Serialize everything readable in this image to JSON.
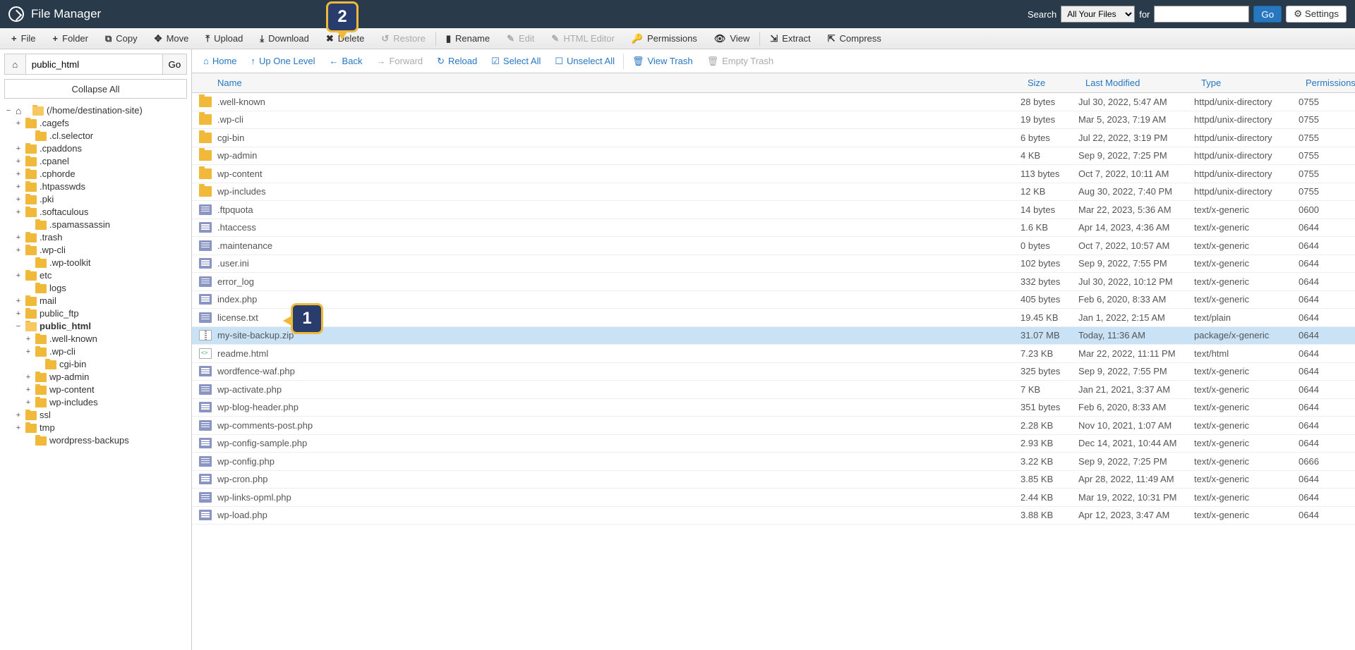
{
  "title": "File Manager",
  "header": {
    "search_label": "Search",
    "search_scope": "All Your Files",
    "for_label": "for",
    "search_value": "",
    "go": "Go",
    "settings": "Settings"
  },
  "toolbar": [
    {
      "id": "file",
      "icon": "+",
      "label": "File",
      "disabled": false
    },
    {
      "id": "folder",
      "icon": "+",
      "label": "Folder",
      "disabled": false
    },
    {
      "id": "copy",
      "icon": "⧉",
      "label": "Copy",
      "disabled": false
    },
    {
      "id": "move",
      "icon": "✥",
      "label": "Move",
      "disabled": false
    },
    {
      "id": "upload",
      "icon": "⤒",
      "label": "Upload",
      "disabled": false
    },
    {
      "id": "download",
      "icon": "⤓",
      "label": "Download",
      "disabled": false
    },
    {
      "id": "delete",
      "icon": "✖",
      "label": "Delete",
      "disabled": false
    },
    {
      "id": "restore",
      "icon": "↺",
      "label": "Restore",
      "disabled": true,
      "sep": true
    },
    {
      "id": "rename",
      "icon": "▮",
      "label": "Rename",
      "disabled": false
    },
    {
      "id": "edit",
      "icon": "✎",
      "label": "Edit",
      "disabled": true
    },
    {
      "id": "htmleditor",
      "icon": "✎",
      "label": "HTML Editor",
      "disabled": true
    },
    {
      "id": "permissions",
      "icon": "🔑",
      "label": "Permissions",
      "disabled": false
    },
    {
      "id": "view",
      "icon": "👁",
      "label": "View",
      "disabled": false,
      "sep": true
    },
    {
      "id": "extract",
      "icon": "⇲",
      "label": "Extract",
      "disabled": false
    },
    {
      "id": "compress",
      "icon": "⇱",
      "label": "Compress",
      "disabled": false
    }
  ],
  "pathbar": {
    "value": "public_html",
    "go": "Go"
  },
  "collapse": "Collapse All",
  "tree": [
    {
      "tw": "−",
      "icon": "home",
      "label": "(/home/destination-site)",
      "depth": 0,
      "open": true
    },
    {
      "tw": "+",
      "icon": "folder",
      "label": ".cagefs",
      "depth": 1
    },
    {
      "tw": "",
      "icon": "folder",
      "label": ".cl.selector",
      "depth": 2
    },
    {
      "tw": "+",
      "icon": "folder",
      "label": ".cpaddons",
      "depth": 1
    },
    {
      "tw": "+",
      "icon": "folder",
      "label": ".cpanel",
      "depth": 1
    },
    {
      "tw": "+",
      "icon": "folder",
      "label": ".cphorde",
      "depth": 1
    },
    {
      "tw": "+",
      "icon": "folder",
      "label": ".htpasswds",
      "depth": 1
    },
    {
      "tw": "+",
      "icon": "folder",
      "label": ".pki",
      "depth": 1
    },
    {
      "tw": "+",
      "icon": "folder",
      "label": ".softaculous",
      "depth": 1
    },
    {
      "tw": "",
      "icon": "folder",
      "label": ".spamassassin",
      "depth": 2
    },
    {
      "tw": "+",
      "icon": "folder",
      "label": ".trash",
      "depth": 1
    },
    {
      "tw": "+",
      "icon": "folder",
      "label": ".wp-cli",
      "depth": 1
    },
    {
      "tw": "",
      "icon": "folder",
      "label": ".wp-toolkit",
      "depth": 2
    },
    {
      "tw": "+",
      "icon": "folder",
      "label": "etc",
      "depth": 1
    },
    {
      "tw": "",
      "icon": "folder",
      "label": "logs",
      "depth": 2
    },
    {
      "tw": "+",
      "icon": "folder",
      "label": "mail",
      "depth": 1
    },
    {
      "tw": "+",
      "icon": "folder",
      "label": "public_ftp",
      "depth": 1
    },
    {
      "tw": "−",
      "icon": "folder",
      "label": "public_html",
      "depth": 1,
      "open": true,
      "bold": true
    },
    {
      "tw": "+",
      "icon": "folder",
      "label": ".well-known",
      "depth": 2
    },
    {
      "tw": "+",
      "icon": "folder",
      "label": ".wp-cli",
      "depth": 2
    },
    {
      "tw": "",
      "icon": "folder",
      "label": "cgi-bin",
      "depth": 3
    },
    {
      "tw": "+",
      "icon": "folder",
      "label": "wp-admin",
      "depth": 2
    },
    {
      "tw": "+",
      "icon": "folder",
      "label": "wp-content",
      "depth": 2
    },
    {
      "tw": "+",
      "icon": "folder",
      "label": "wp-includes",
      "depth": 2
    },
    {
      "tw": "+",
      "icon": "folder",
      "label": "ssl",
      "depth": 1
    },
    {
      "tw": "+",
      "icon": "folder",
      "label": "tmp",
      "depth": 1
    },
    {
      "tw": "",
      "icon": "folder",
      "label": "wordpress-backups",
      "depth": 2
    }
  ],
  "actionbar": [
    {
      "id": "home",
      "icon": "⌂",
      "label": "Home"
    },
    {
      "id": "up",
      "icon": "↑",
      "label": "Up One Level"
    },
    {
      "id": "back",
      "icon": "←",
      "label": "Back"
    },
    {
      "id": "forward",
      "icon": "→",
      "label": "Forward",
      "dis": true
    },
    {
      "id": "reload",
      "icon": "↻",
      "label": "Reload"
    },
    {
      "id": "selectall",
      "icon": "☑",
      "label": "Select All"
    },
    {
      "id": "unselectall",
      "icon": "☐",
      "label": "Unselect All",
      "sep": true
    },
    {
      "id": "viewtrash",
      "icon": "🗑",
      "label": "View Trash"
    },
    {
      "id": "emptytrash",
      "icon": "🗑",
      "label": "Empty Trash",
      "dis": true
    }
  ],
  "columns": {
    "name": "Name",
    "size": "Size",
    "mod": "Last Modified",
    "type": "Type",
    "perm": "Permissions"
  },
  "files": [
    {
      "icon": "folder",
      "name": ".well-known",
      "size": "28 bytes",
      "mod": "Jul 30, 2022, 5:47 AM",
      "type": "httpd/unix-directory",
      "perm": "0755"
    },
    {
      "icon": "folder",
      "name": ".wp-cli",
      "size": "19 bytes",
      "mod": "Mar 5, 2023, 7:19 AM",
      "type": "httpd/unix-directory",
      "perm": "0755"
    },
    {
      "icon": "folder",
      "name": "cgi-bin",
      "size": "6 bytes",
      "mod": "Jul 22, 2022, 3:19 PM",
      "type": "httpd/unix-directory",
      "perm": "0755"
    },
    {
      "icon": "folder",
      "name": "wp-admin",
      "size": "4 KB",
      "mod": "Sep 9, 2022, 7:25 PM",
      "type": "httpd/unix-directory",
      "perm": "0755"
    },
    {
      "icon": "folder",
      "name": "wp-content",
      "size": "113 bytes",
      "mod": "Oct 7, 2022, 10:11 AM",
      "type": "httpd/unix-directory",
      "perm": "0755"
    },
    {
      "icon": "folder",
      "name": "wp-includes",
      "size": "12 KB",
      "mod": "Aug 30, 2022, 7:40 PM",
      "type": "httpd/unix-directory",
      "perm": "0755"
    },
    {
      "icon": "file",
      "name": ".ftpquota",
      "size": "14 bytes",
      "mod": "Mar 22, 2023, 5:36 AM",
      "type": "text/x-generic",
      "perm": "0600"
    },
    {
      "icon": "file",
      "name": ".htaccess",
      "size": "1.6 KB",
      "mod": "Apr 14, 2023, 4:36 AM",
      "type": "text/x-generic",
      "perm": "0644"
    },
    {
      "icon": "file",
      "name": ".maintenance",
      "size": "0 bytes",
      "mod": "Oct 7, 2022, 10:57 AM",
      "type": "text/x-generic",
      "perm": "0644"
    },
    {
      "icon": "file",
      "name": ".user.ini",
      "size": "102 bytes",
      "mod": "Sep 9, 2022, 7:55 PM",
      "type": "text/x-generic",
      "perm": "0644"
    },
    {
      "icon": "file",
      "name": "error_log",
      "size": "332 bytes",
      "mod": "Jul 30, 2022, 10:12 PM",
      "type": "text/x-generic",
      "perm": "0644"
    },
    {
      "icon": "file",
      "name": "index.php",
      "size": "405 bytes",
      "mod": "Feb 6, 2020, 8:33 AM",
      "type": "text/x-generic",
      "perm": "0644"
    },
    {
      "icon": "file",
      "name": "license.txt",
      "size": "19.45 KB",
      "mod": "Jan 1, 2022, 2:15 AM",
      "type": "text/plain",
      "perm": "0644"
    },
    {
      "icon": "zip",
      "name": "my-site-backup.zip",
      "size": "31.07 MB",
      "mod": "Today, 11:36 AM",
      "type": "package/x-generic",
      "perm": "0644",
      "selected": true
    },
    {
      "icon": "html",
      "name": "readme.html",
      "size": "7.23 KB",
      "mod": "Mar 22, 2022, 11:11 PM",
      "type": "text/html",
      "perm": "0644"
    },
    {
      "icon": "file",
      "name": "wordfence-waf.php",
      "size": "325 bytes",
      "mod": "Sep 9, 2022, 7:55 PM",
      "type": "text/x-generic",
      "perm": "0644"
    },
    {
      "icon": "file",
      "name": "wp-activate.php",
      "size": "7 KB",
      "mod": "Jan 21, 2021, 3:37 AM",
      "type": "text/x-generic",
      "perm": "0644"
    },
    {
      "icon": "file",
      "name": "wp-blog-header.php",
      "size": "351 bytes",
      "mod": "Feb 6, 2020, 8:33 AM",
      "type": "text/x-generic",
      "perm": "0644"
    },
    {
      "icon": "file",
      "name": "wp-comments-post.php",
      "size": "2.28 KB",
      "mod": "Nov 10, 2021, 1:07 AM",
      "type": "text/x-generic",
      "perm": "0644"
    },
    {
      "icon": "file",
      "name": "wp-config-sample.php",
      "size": "2.93 KB",
      "mod": "Dec 14, 2021, 10:44 AM",
      "type": "text/x-generic",
      "perm": "0644"
    },
    {
      "icon": "file",
      "name": "wp-config.php",
      "size": "3.22 KB",
      "mod": "Sep 9, 2022, 7:25 PM",
      "type": "text/x-generic",
      "perm": "0666"
    },
    {
      "icon": "file",
      "name": "wp-cron.php",
      "size": "3.85 KB",
      "mod": "Apr 28, 2022, 11:49 AM",
      "type": "text/x-generic",
      "perm": "0644"
    },
    {
      "icon": "file",
      "name": "wp-links-opml.php",
      "size": "2.44 KB",
      "mod": "Mar 19, 2022, 10:31 PM",
      "type": "text/x-generic",
      "perm": "0644"
    },
    {
      "icon": "file",
      "name": "wp-load.php",
      "size": "3.88 KB",
      "mod": "Apr 12, 2023, 3:47 AM",
      "type": "text/x-generic",
      "perm": "0644"
    }
  ],
  "callouts": {
    "1": "1",
    "2": "2"
  }
}
